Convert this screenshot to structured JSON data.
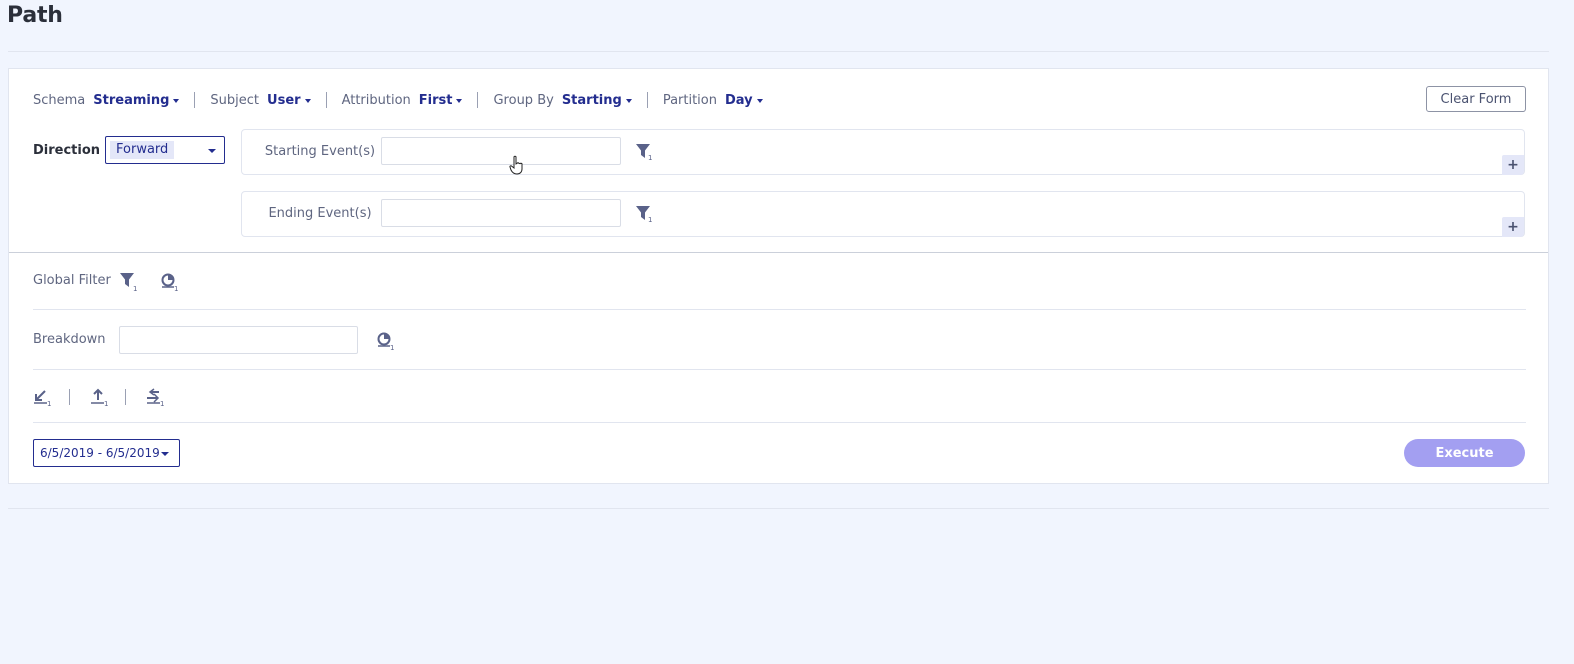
{
  "page": {
    "title": "Path"
  },
  "options": {
    "schema": {
      "label": "Schema",
      "value": "Streaming"
    },
    "subject": {
      "label": "Subject",
      "value": "User"
    },
    "attribution": {
      "label": "Attribution",
      "value": "First"
    },
    "group_by": {
      "label": "Group By",
      "value": "Starting"
    },
    "partition": {
      "label": "Partition",
      "value": "Day"
    }
  },
  "clear_form_label": "Clear Form",
  "direction": {
    "label": "Direction",
    "value": "Forward"
  },
  "starting_events": {
    "label": "Starting Event(s)",
    "value": "",
    "filter_count": "1"
  },
  "ending_events": {
    "label": "Ending Event(s)",
    "value": "",
    "filter_count": "1"
  },
  "plus_label": "+",
  "global_filter": {
    "label": "Global Filter",
    "filter_count": "1",
    "segment_count": "1"
  },
  "breakdown": {
    "label": "Breakdown",
    "value": "",
    "count": "1"
  },
  "actions": [
    {
      "icon": "import-icon",
      "count": "1"
    },
    {
      "icon": "upload-icon",
      "count": "1"
    },
    {
      "icon": "swap-icon",
      "count": "1"
    }
  ],
  "date_range": "6/5/2019 - 6/5/2019",
  "execute_label": "Execute",
  "colors": {
    "accent": "#232d8f",
    "execute": "#a39ff1",
    "background": "#f1f5fe",
    "icon": "#5a6289"
  }
}
